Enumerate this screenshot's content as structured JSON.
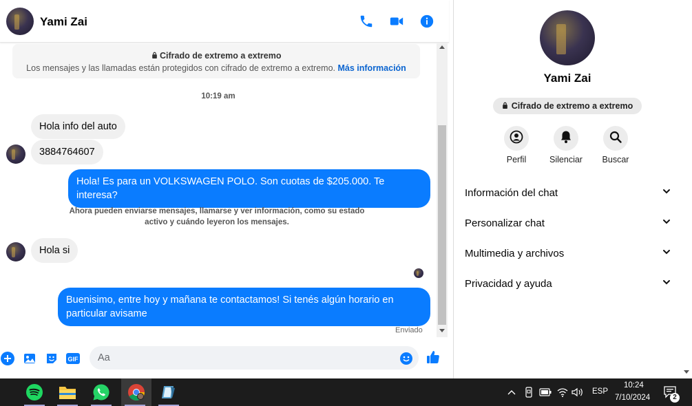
{
  "chat": {
    "header": {
      "name": "Yami Zai"
    },
    "encryption": {
      "title": "Cifrado de extremo a extremo",
      "description": "Los mensajes y las llamadas están protegidos con cifrado de extremo a extremo.",
      "link": "Más información"
    },
    "timestamp": "10:19 am",
    "messages": [
      {
        "direction": "in",
        "text": "Hola info del auto"
      },
      {
        "direction": "in",
        "text": "3884764607"
      },
      {
        "direction": "out",
        "text": "Hola! Es para un VOLKSWAGEN POLO. Son cuotas de $205.000.  Te interesa?"
      },
      {
        "direction": "in",
        "text": "Hola si"
      },
      {
        "direction": "out",
        "text": "Buenisimo, entre hoy y mañana te contactamos! Si tenés algún horario en particular avisame"
      }
    ],
    "system_note": "Ahora pueden enviarse mensajes, llamarse y ver información, como su estado activo y cuándo leyeron los mensajes.",
    "sent_status": "Enviado",
    "composer": {
      "placeholder": "Aa",
      "gif_label": "GIF"
    }
  },
  "info": {
    "name": "Yami Zai",
    "encryption_pill": "Cifrado de extremo a extremo",
    "actions": [
      {
        "label": "Perfil"
      },
      {
        "label": "Silenciar"
      },
      {
        "label": "Buscar"
      }
    ],
    "sections": [
      {
        "label": "Información del chat"
      },
      {
        "label": "Personalizar chat"
      },
      {
        "label": "Multimedia y archivos"
      },
      {
        "label": "Privacidad y ayuda"
      }
    ]
  },
  "taskbar": {
    "apps": [
      "spotify",
      "file-explorer",
      "whatsapp",
      "chrome",
      "notes"
    ],
    "language": "ESP",
    "time": "10:24",
    "date": "7/10/2024",
    "notification_count": "2"
  },
  "colors": {
    "accent": "#0a7cff",
    "incoming_bubble": "#f0f0f0",
    "taskbar": "#1c1c1c"
  }
}
